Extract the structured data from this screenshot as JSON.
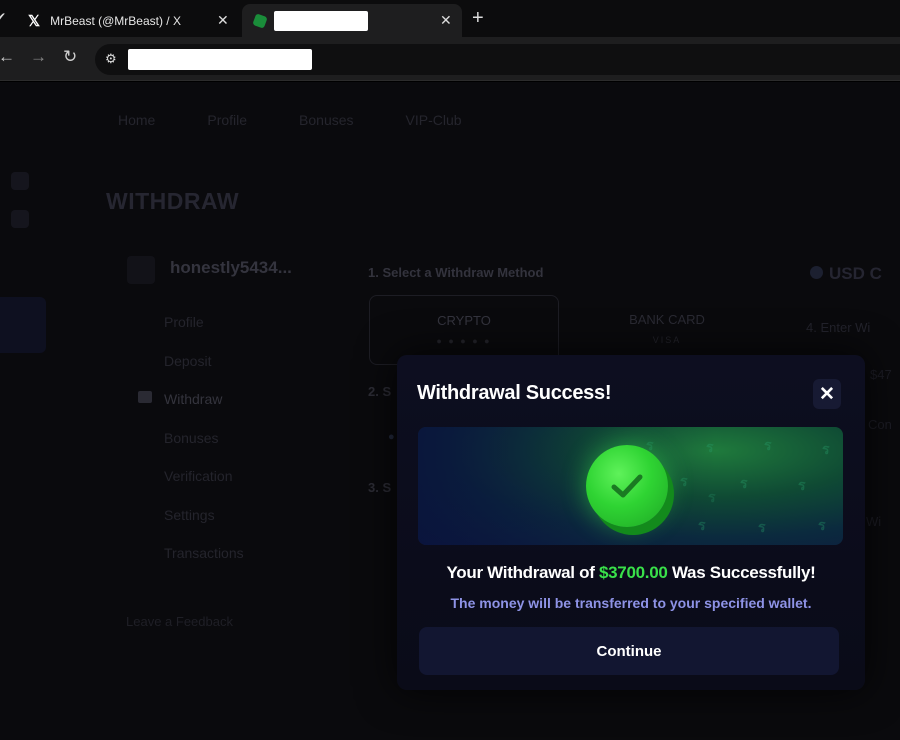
{
  "browser": {
    "tabs": [
      {
        "title": "MrBeast (@MrBeast) / X",
        "icon": "x-logo-icon"
      },
      {
        "title": "",
        "icon": "site-favicon",
        "redacted": true
      }
    ],
    "address_redacted": true
  },
  "page": {
    "nav": [
      "Home",
      "Profile",
      "Bonuses",
      "VIP-Club"
    ],
    "title": "WITHDRAW",
    "username": "honestly5434...",
    "sidebar": [
      "Profile",
      "Deposit",
      "Withdraw",
      "Bonuses",
      "Verification",
      "Settings",
      "Transactions"
    ],
    "leave_feedback": "Leave a Feedback",
    "step1": "1. Select a Withdraw Method",
    "methods": [
      {
        "label": "CRYPTO",
        "sub": "● ● ● ● ●"
      },
      {
        "label": "BANK CARD",
        "sub": "VISA"
      }
    ],
    "step2": "2. S",
    "step3": "3. S",
    "currency": "USD C",
    "step4": "4. Enter Wi",
    "right_fragments": [
      "$47",
      "Con",
      "Wi"
    ]
  },
  "modal": {
    "title": "Withdrawal Success!",
    "message_prefix": "Your Withdrawal of ",
    "amount": "$3700.00",
    "message_suffix": " Was Successfully!",
    "subtext": "The money will be transferred to your specified wallet.",
    "continue_label": "Continue",
    "colors": {
      "accent_green": "#39e04a",
      "subtext": "#8e93e6",
      "button_bg": "#121631"
    }
  }
}
